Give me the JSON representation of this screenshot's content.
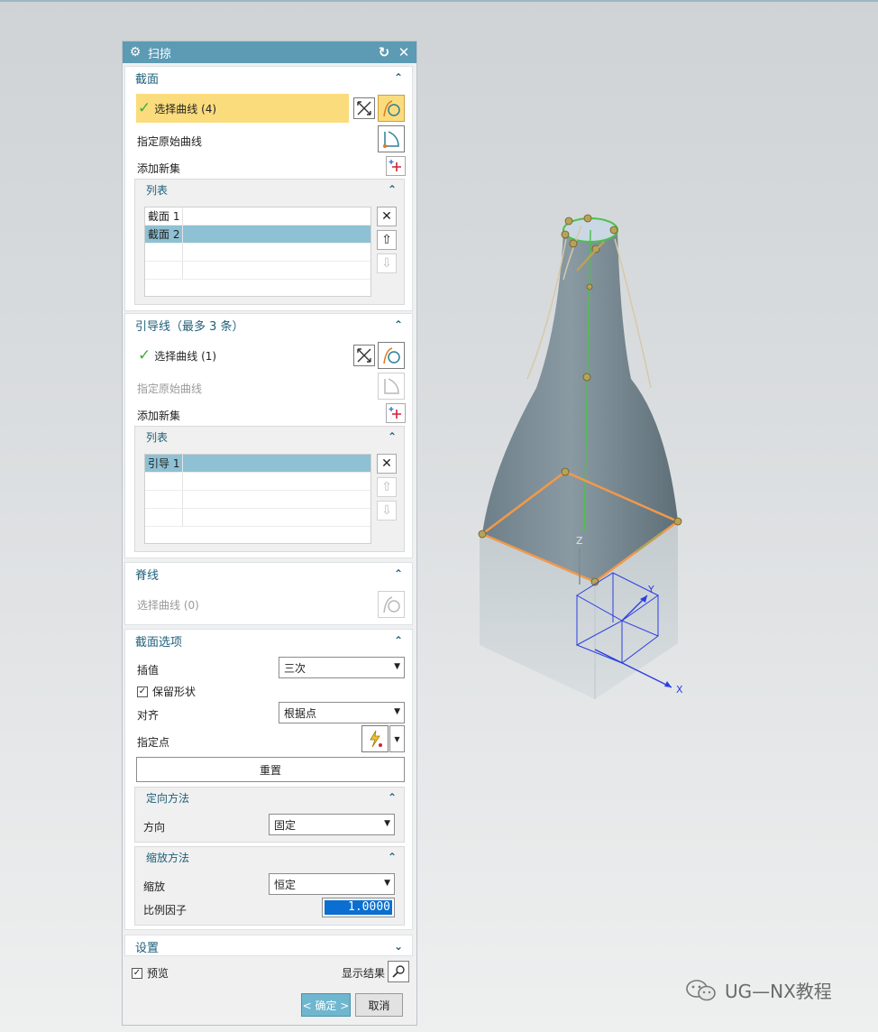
{
  "dialog": {
    "title": "扫掠",
    "reset_icon": "reset-icon",
    "close_icon": "close-icon"
  },
  "section": {
    "header": "截面",
    "select_curve": "选择曲线 (4)",
    "specify_original": "指定原始曲线",
    "add_new_set": "添加新集",
    "list_header": "列表",
    "items": [
      "截面 1",
      "截面 2"
    ]
  },
  "guide": {
    "header": "引导线（最多 3 条）",
    "select_curve": "选择曲线 (1)",
    "specify_original": "指定原始曲线",
    "add_new_set": "添加新集",
    "list_header": "列表",
    "items": [
      "引导 1"
    ]
  },
  "spine": {
    "header": "脊线",
    "select_curve": "选择曲线 (0)"
  },
  "section_options": {
    "header": "截面选项",
    "interp_label": "插值",
    "interp_value": "三次",
    "preserve_shape": "保留形状",
    "preserve_checked": true,
    "align_label": "对齐",
    "align_value": "根据点",
    "specify_point": "指定点",
    "reset_button": "重置",
    "orientation_header": "定向方法",
    "orientation_label": "方向",
    "orientation_value": "固定",
    "scaling_header": "缩放方法",
    "scaling_label": "缩放",
    "scaling_value": "恒定",
    "scale_factor_label": "比例因子",
    "scale_factor_value": "1.0000"
  },
  "settings": {
    "header": "设置",
    "preview": "预览",
    "preview_checked": true,
    "show_result": "显示结果"
  },
  "buttons": {
    "ok": "< 确定 >",
    "cancel": "取消"
  },
  "viewport": {
    "axis_x": "X",
    "axis_y": "Y",
    "axis_z": "Z"
  },
  "watermark": "UG—NX教程",
  "colors": {
    "title_bar": "#5d9ab3",
    "header_text": "#1e5f79",
    "active_row": "#fbdc7d",
    "list_selected": "#8ec1d4",
    "section_curve": "#f2994a",
    "guide_curve": "#4cc14c"
  }
}
